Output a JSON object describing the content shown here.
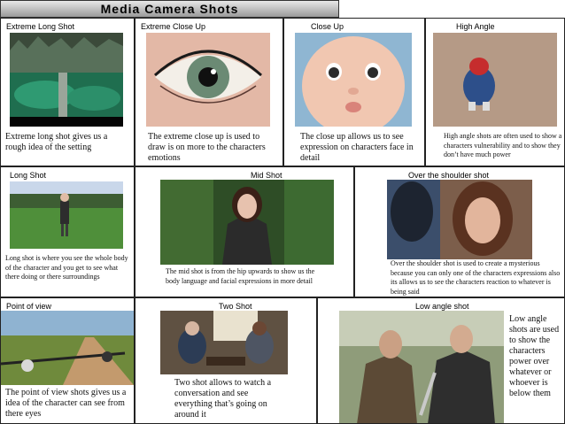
{
  "title": "Media  Camera  Shots",
  "shots": {
    "extreme_long": {
      "label": "Extreme  Long  Shot",
      "description": "Extreme long shot gives us a rough idea of the setting"
    },
    "extreme_close": {
      "label": "Extreme  Close  Up",
      "description": "The extreme close up is used to draw is on more to the characters emotions"
    },
    "close_up": {
      "label": "Close  Up",
      "description": "The close up allows us to see expression on characters face in detail"
    },
    "high_angle": {
      "label": "High  Angle",
      "description": "High angle shots are often used to show a characters vulnerability and to show they don’t have much power"
    },
    "long_shot": {
      "label": "Long  Shot",
      "description": "Long shot is where you see the whole body of the character and you get to see what there doing or there surroundings"
    },
    "mid_shot": {
      "label": "Mid  Shot",
      "description": "The mid shot is from the hip upwards to show us the body language and facial expressions in more detail"
    },
    "over_shoulder": {
      "label": "Over  the  shoulder  shot",
      "description": "Over the shoulder shot is used to create a mysterious because you can only one of the characters expressions also its allows us to see the characters reaction to whatever is being said"
    },
    "point_of_view": {
      "label": "Point  of  view",
      "description": "The point of view shots gives us a idea of the character can see from there eyes"
    },
    "two_shot": {
      "label": "Two  Shot",
      "description": "Two shot allows to watch a conversation and see everything that’s going on around it"
    },
    "low_angle": {
      "label": "Low  angle  shot",
      "description": "Low angle shots are used to show the characters power over whatever or whoever is below them"
    }
  },
  "colors": {
    "border": "#222222",
    "title_top": "#e8e8e8",
    "title_bottom": "#9a9a9a"
  }
}
